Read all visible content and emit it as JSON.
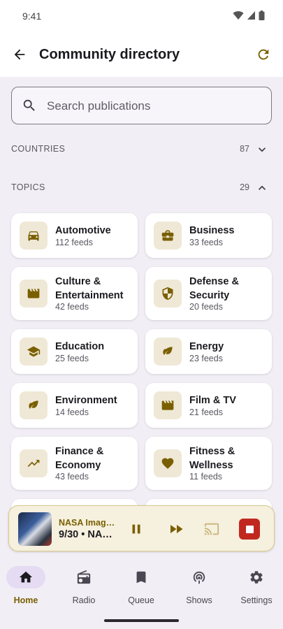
{
  "status_bar": {
    "time": "9:41"
  },
  "app_bar": {
    "title": "Community directory"
  },
  "search": {
    "placeholder": "Search publications"
  },
  "sections": {
    "countries": {
      "label": "COUNTRIES",
      "count": "87"
    },
    "topics": {
      "label": "TOPICS",
      "count": "29"
    }
  },
  "topics": [
    {
      "name": "Automotive",
      "feeds": "112 feeds",
      "icon": "car-icon"
    },
    {
      "name": "Business",
      "feeds": "33 feeds",
      "icon": "briefcase-icon"
    },
    {
      "name": "Culture & Entertainment",
      "feeds": "42 feeds",
      "icon": "clapperboard-icon"
    },
    {
      "name": "Defense & Security",
      "feeds": "20 feeds",
      "icon": "shield-icon"
    },
    {
      "name": "Education",
      "feeds": "25 feeds",
      "icon": "graduation-cap-icon"
    },
    {
      "name": "Energy",
      "feeds": "23 feeds",
      "icon": "leaf-icon"
    },
    {
      "name": "Environment",
      "feeds": "14 feeds",
      "icon": "leaf-icon"
    },
    {
      "name": "Film & TV",
      "feeds": "21 feeds",
      "icon": "clapperboard-icon"
    },
    {
      "name": "Finance & Economy",
      "feeds": "43 feeds",
      "icon": "trending-up-icon"
    },
    {
      "name": "Fitness & Wellness",
      "feeds": "11 feeds",
      "icon": "heart-icon"
    }
  ],
  "player": {
    "title": "NASA Imag…",
    "subtitle": "9/30 • NA…"
  },
  "bottom_nav": [
    {
      "label": "Home",
      "icon": "home-icon",
      "active": true
    },
    {
      "label": "Radio",
      "icon": "radio-icon",
      "active": false
    },
    {
      "label": "Queue",
      "icon": "bookmark-icon",
      "active": false
    },
    {
      "label": "Shows",
      "icon": "podcast-icon",
      "active": false
    },
    {
      "label": "Settings",
      "icon": "gear-icon",
      "active": false
    }
  ],
  "colors": {
    "accent": "#7a5f00",
    "badge_bg": "#efe8d6",
    "stop": "#c0281f",
    "nav_active_bg": "#e5dbf2"
  }
}
